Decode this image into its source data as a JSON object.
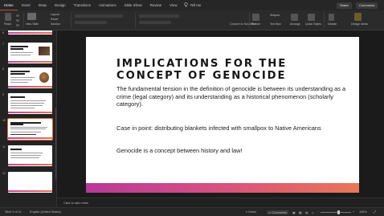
{
  "menu": {
    "tabs": [
      "Home",
      "Insert",
      "Draw",
      "Design",
      "Transitions",
      "Animations",
      "Slide Show",
      "Review",
      "View"
    ],
    "active_tab": "Home",
    "tell_me": "Tell me",
    "share": "Share",
    "comments": "Comments"
  },
  "ribbon": {
    "paste": "Paste",
    "new_slide": "New Slide",
    "layout": "Layout",
    "reset": "Reset",
    "section": "Section",
    "shapes": "Shapes",
    "text_box": "Text Box",
    "arrange": "Arrange",
    "quick_styles": "Quick Styles",
    "picture": "Picture",
    "convert_smartart": "Convert to SmartArt",
    "dictate": "Dictate",
    "add_ins": "Add-ins",
    "designer": "Design Ideas"
  },
  "thumbnails": [
    {
      "num": "6"
    },
    {
      "num": "7",
      "title": "FROM FIRST CONTACT"
    },
    {
      "num": "8",
      "title": "LEMKIN (1900–1959)"
    },
    {
      "num": "9",
      "title": "GENOCIDE"
    },
    {
      "num": "10",
      "title": "IMPLICATIONS FOR THE CONCEPT OF GENOCIDE",
      "selected": true
    },
    {
      "num": "11",
      "title": "REVIEW"
    },
    {
      "num": "12"
    }
  ],
  "slide": {
    "title": "IMPLICATIONS FOR THE CONCEPT OF GENOCIDE",
    "body1": "The fundamental tension in the definition of genocide is between its understanding as a crime (legal category) and its understanding as a historical phenomenon (scholarly category).",
    "body2": "Case in point: distributing blankets infected with smallpox to Native Americans",
    "body3": "Genocide is a concept between history and law!"
  },
  "notes": {
    "placeholder": "Click to add notes"
  },
  "status": {
    "slide_position": "Slide 9 of 11",
    "language": "English (United States)",
    "notes": "Notes",
    "comments": "Comments",
    "zoom": "108%"
  },
  "colors": {
    "accent_start": "#b73a98",
    "accent_end": "#e7785a",
    "selection": "#e06c3c"
  }
}
